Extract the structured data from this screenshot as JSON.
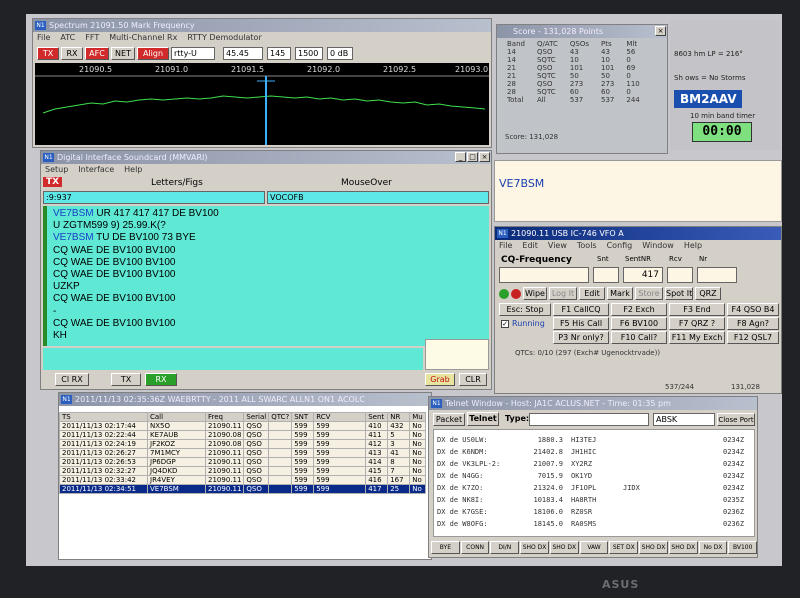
{
  "freq_window": {
    "title": "Spectrum 21091.50 Mark Frequency",
    "menu": [
      "File",
      "ATC",
      "FFT",
      "Multi-Channel Rx",
      "RTTY Demodulator"
    ],
    "buttons": {
      "tx": "TX",
      "rx": "RX",
      "afc": "AFC",
      "net": "NET",
      "align": "Align"
    },
    "mode_select": "rtty-U",
    "baud_select": "45.45",
    "field1": "145",
    "field2": "1500",
    "field3": "0 dB",
    "scale_labels": [
      "21090.5",
      "21091.0",
      "21091.5",
      "21092.0",
      "21092.5",
      "21093.0"
    ]
  },
  "score_window": {
    "title": "Score - 131,028 Points",
    "headers": [
      "Band",
      "Q/ATC",
      "QSOs",
      "Pts",
      "Mlt"
    ],
    "rows": [
      [
        "14",
        "QSO",
        "43",
        "43",
        "56"
      ],
      [
        "14",
        "SQTC",
        "10",
        "10",
        "0"
      ],
      [
        "21",
        "QSO",
        "101",
        "101",
        "69"
      ],
      [
        "21",
        "SQTC",
        "50",
        "50",
        "0"
      ],
      [
        "28",
        "QSO",
        "273",
        "273",
        "110"
      ],
      [
        "28",
        "SQTC",
        "60",
        "60",
        "0"
      ],
      [
        "Total",
        "All",
        "537",
        "537",
        "244"
      ]
    ],
    "score_line": "Score: 131,028"
  },
  "right_top": {
    "line1": "8603 hm LP = 216°",
    "line2": "Sh  ows = No Storms",
    "callsign": "BM2AAV",
    "timer_label": "10 min band timer",
    "timer_value": "00:00"
  },
  "soundcard_window": {
    "title": "Digital Interface Soundcard (MMVARI)",
    "menu": [
      "Setup",
      "Interface",
      "Help"
    ],
    "tx_label": "TX",
    "letters_label": "Letters/Figs",
    "mouseover_label": "MouseOver",
    "field_left": ":9:937",
    "field_right": "VOCOFB",
    "rx_lines": [
      {
        "call": "VE7BSM",
        "text": " UR 417 417 417 DE BV100"
      },
      {
        "call": "",
        "text": "U ZGTM599 9) 25.99.K(?"
      },
      {
        "call": "VE7BSM",
        "text": " TU DE BV100 73 BYE"
      },
      {
        "call": "",
        "text": " CQ  WAE DE BV100 BV100"
      },
      {
        "call": "",
        "text": " CQ  WAE DE BV100 BV100"
      },
      {
        "call": "",
        "text": " CQ  WAE DE BV100 BV100"
      },
      {
        "call": "",
        "text": "UZKP"
      },
      {
        "call": "",
        "text": " CQ  WAE DE BV100 BV100"
      },
      {
        "call": "",
        "text": "-"
      },
      {
        "call": "",
        "text": " CQ  WAE DE BV100 BV100"
      },
      {
        "call": "",
        "text": "KH"
      }
    ],
    "clear_rx": "Cl RX",
    "tx_btn": "TX",
    "rx_btn": "RX",
    "grab_btn": "Grab",
    "clr_btn": "CLR"
  },
  "call_display": "VE7BSM",
  "entry_window": {
    "title": "21090.11 USB IC-746 VFO A",
    "menu": [
      "File",
      "Edit",
      "View",
      "Tools",
      "Config",
      "Window",
      "Help"
    ],
    "group_label": "CQ-Frequency",
    "col_labels": [
      "Snt",
      "SentNR",
      "Rcv",
      "Nr"
    ],
    "sentnr_value": "417",
    "toolbar": [
      "Wipe",
      "Log It",
      "Edit",
      "Mark",
      "Store",
      "Spot It",
      "QRZ"
    ],
    "fkeys": [
      [
        "Esc: Stop",
        "F1 CallCQ",
        "F2 Exch",
        "F3 End",
        "F4 QSO B4"
      ],
      [
        "Running",
        "F5 His Call",
        "F6 BV100",
        "F7 QRZ ?",
        "F8 Agn?"
      ],
      [
        "",
        "P3 Nr only?",
        "F10 Call?",
        "F11 My Exch",
        "F12 QSL7"
      ]
    ],
    "status_line": "QTCs: 0/10 (297 (Exch# Ugenocktrvade))",
    "bottom_left": "537/244",
    "bottom_right": "131,028"
  },
  "log_window": {
    "title": "2011/11/13 02:35:36Z  WAEBRTTY  - 2011 ALL SWARC  ALLN1 ON1  ACOLC",
    "headers": [
      "TS",
      "Call",
      "Freq",
      "Serial",
      "QTC?",
      "SNT",
      "RCV",
      "Sent",
      "NR",
      "Mu"
    ],
    "rows": [
      [
        "2011/11/13 02:17:44",
        "NX5O",
        "21090.11",
        "QSO",
        "",
        "599",
        "599",
        "410",
        "432",
        "No"
      ],
      [
        "2011/11/13 02:22:44",
        "KE7AUB",
        "21090.08",
        "QSO",
        "",
        "599",
        "599",
        "411",
        "5",
        "No"
      ],
      [
        "2011/11/13 02:24:19",
        "JF2KOZ",
        "21090.08",
        "QSO",
        "",
        "599",
        "599",
        "412",
        "3",
        "No"
      ],
      [
        "2011/11/13 02:26:27",
        "7M1MCY",
        "21090.11",
        "QSO",
        "",
        "599",
        "599",
        "413",
        "41",
        "No"
      ],
      [
        "2011/11/13 02:26:53",
        "JP6DGP",
        "21090.11",
        "QSO",
        "",
        "599",
        "599",
        "414",
        "8",
        "No"
      ],
      [
        "2011/11/13 02:32:27",
        "JQ4DKD",
        "21090.11",
        "QSO",
        "",
        "599",
        "599",
        "415",
        "7",
        "No"
      ],
      [
        "2011/11/13 02:33:42",
        "JR4VEY",
        "21090.11",
        "QSO",
        "",
        "599",
        "599",
        "416",
        "167",
        "No"
      ],
      [
        "2011/11/13 02:34:51",
        "VE7BSM",
        "21090.11",
        "QSO",
        "",
        "599",
        "599",
        "417",
        "25",
        "No"
      ]
    ]
  },
  "telnet_window": {
    "title": "Telnet Window - Host: JA1C ACLUS.NET - Time: 01:35 pm",
    "tabs": [
      "Packet",
      "Telnet"
    ],
    "type_label": "Type:",
    "band_select": "ABSK",
    "close_port": "Close Port",
    "spots": [
      [
        "DX de US0LW:",
        "1880.3",
        "HI3TEJ",
        "",
        "0234Z"
      ],
      [
        "DX de K6NDM:",
        "21402.8",
        "JH1HIC",
        "",
        "0234Z"
      ],
      [
        "DX de VK3LPL-2:",
        "21007.9",
        "XY2RZ",
        "",
        "0234Z"
      ],
      [
        "DX de N4GG:",
        "7015.9",
        "OK1YD",
        "",
        "0234Z"
      ],
      [
        "DX de K7ZO:",
        "21324.0",
        "JF1OPL",
        "JIDX",
        "0234Z"
      ],
      [
        "DX de NK8I:",
        "10183.4",
        "HA8RTH",
        "",
        "0235Z"
      ],
      [
        "DX de K7GSE:",
        "18106.0",
        "RZ0SR",
        "",
        "0236Z"
      ],
      [
        "DX de W8OFG:",
        "18145.0",
        "RA0SMS",
        "",
        "0236Z"
      ]
    ],
    "bottom_buttons": [
      "BYE",
      "CONN",
      "DI/N",
      "SHO DX",
      "SHO DX",
      "VAW",
      "SET DX",
      "SHO DX",
      "SHO DX",
      "No DX",
      "BV100"
    ]
  },
  "monitor_brand": "ASUS"
}
